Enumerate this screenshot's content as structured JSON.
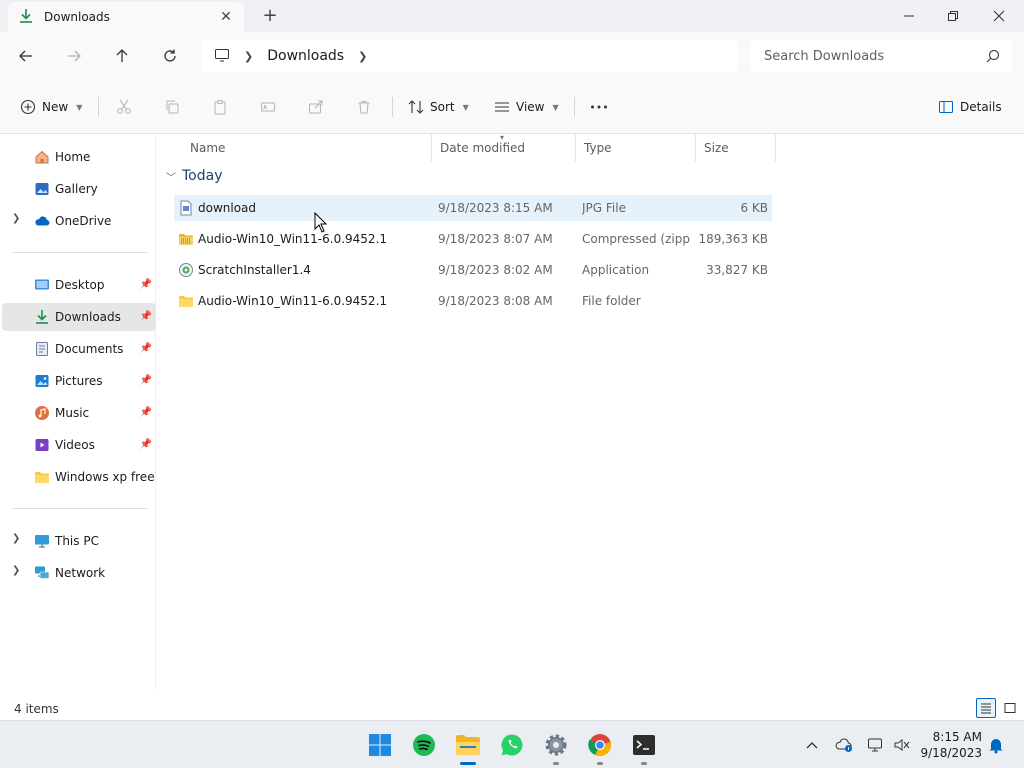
{
  "window": {
    "tab_title": "Downloads",
    "colors": {
      "accent": "#0067c0",
      "folder": "#f7c948",
      "download_green": "#1a8f4e"
    }
  },
  "address": {
    "breadcrumbs": [
      "Downloads"
    ],
    "search_placeholder": "Search Downloads"
  },
  "toolbar": {
    "new_label": "New",
    "sort_label": "Sort",
    "view_label": "View",
    "details_label": "Details"
  },
  "sidebar": {
    "top": [
      {
        "label": "Home",
        "icon": "home-icon"
      },
      {
        "label": "Gallery",
        "icon": "gallery-icon"
      },
      {
        "label": "OneDrive",
        "icon": "cloud-icon"
      }
    ],
    "pinned": [
      {
        "label": "Desktop",
        "icon": "desktop-icon"
      },
      {
        "label": "Downloads",
        "icon": "download-icon",
        "selected": true
      },
      {
        "label": "Documents",
        "icon": "documents-icon"
      },
      {
        "label": "Pictures",
        "icon": "pictures-icon"
      },
      {
        "label": "Music",
        "icon": "music-icon"
      },
      {
        "label": "Videos",
        "icon": "videos-icon"
      },
      {
        "label": "Windows xp free",
        "icon": "folder-icon"
      }
    ],
    "bottom": [
      {
        "label": "This PC",
        "icon": "pc-icon"
      },
      {
        "label": "Network",
        "icon": "network-icon"
      }
    ]
  },
  "filelist": {
    "columns": [
      "Name",
      "Date modified",
      "Type",
      "Size"
    ],
    "group_label": "Today",
    "rows": [
      {
        "name": "download",
        "date": "9/18/2023 8:15 AM",
        "type": "JPG File",
        "size": "6 KB",
        "icon": "image-file-icon",
        "selected": true
      },
      {
        "name": "Audio-Win10_Win11-6.0.9452.1",
        "date": "9/18/2023 8:07 AM",
        "type": "Compressed (zipp...",
        "size": "189,363 KB",
        "icon": "zip-folder-icon"
      },
      {
        "name": "ScratchInstaller1.4",
        "date": "9/18/2023 8:02 AM",
        "type": "Application",
        "size": "33,827 KB",
        "icon": "app-icon"
      },
      {
        "name": "Audio-Win10_Win11-6.0.9452.1",
        "date": "9/18/2023 8:08 AM",
        "type": "File folder",
        "size": "",
        "icon": "folder-icon"
      }
    ]
  },
  "status": {
    "item_count": "4 items"
  },
  "taskbar": {
    "apps": [
      "start-icon",
      "spotify-icon",
      "file-explorer-icon",
      "whatsapp-icon",
      "settings-icon",
      "chrome-icon",
      "terminal-icon"
    ],
    "time": "8:15 AM",
    "date": "9/18/2023"
  }
}
